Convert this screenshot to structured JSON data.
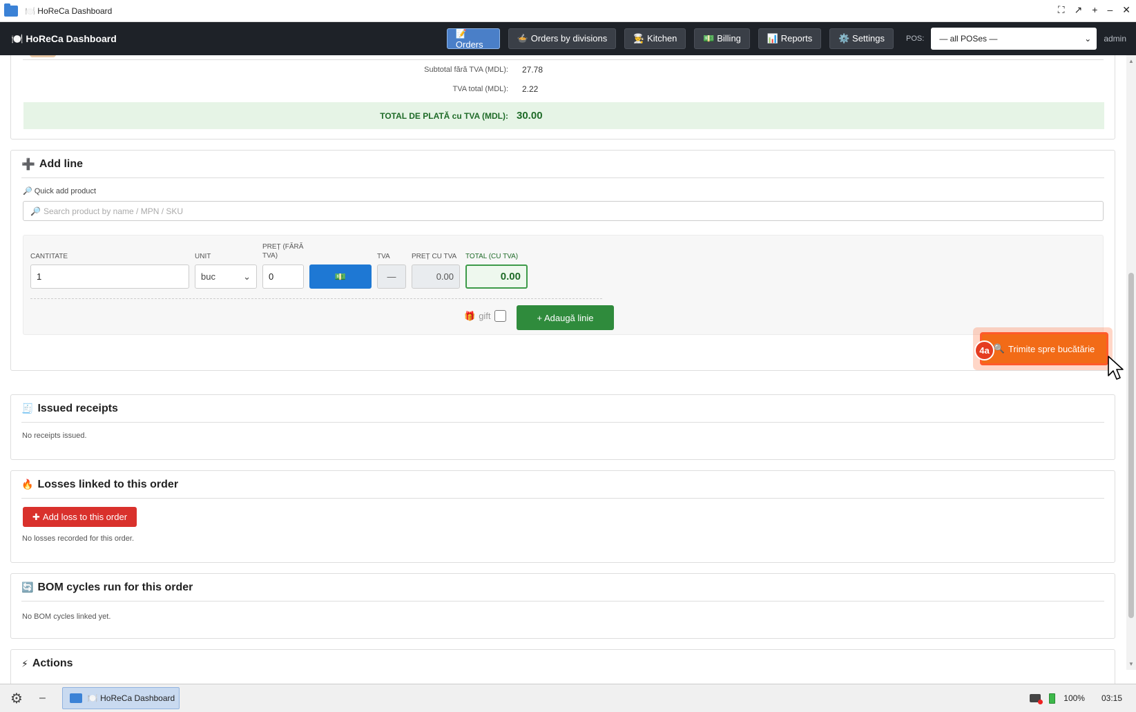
{
  "window": {
    "title": "🍽️ HoReCa Dashboard",
    "controls": [
      "⛶",
      "↗",
      "+",
      "–",
      "✕"
    ]
  },
  "header": {
    "brand": "🍽️ HoReCa Dashboard",
    "nav": [
      {
        "label": "📝 Orders",
        "active": true
      },
      {
        "label": "🍲 Orders by divisions",
        "active": false
      },
      {
        "label": "👨‍🍳 Kitchen",
        "active": false
      },
      {
        "label": "💵 Billing",
        "active": false
      },
      {
        "label": "📊 Reports",
        "active": false
      },
      {
        "label": "⚙️ Settings",
        "active": false
      }
    ],
    "pos_label": "POS:",
    "pos_selected": "— all POSes —",
    "user": "admin"
  },
  "totals": {
    "subtotal_label": "Subtotal fără TVA (MDL):",
    "subtotal_value": "27.78",
    "vat_label": "TVA total (MDL):",
    "vat_value": "2.22",
    "grand_label": "TOTAL DE PLATĂ cu TVA (MDL):",
    "grand_value": "30.00"
  },
  "add_line": {
    "title": "Add line",
    "quick_add_label": "🔎 Quick add product",
    "search_placeholder": "Search product by name / MPN / SKU",
    "fields": {
      "qty_label": "CANTITATE",
      "qty_value": "1",
      "unit_label": "UNIT",
      "unit_value": "buc",
      "price_label": "PREȚ (FĂRĂ TVA)",
      "price_value": "0",
      "price_btn": "💵",
      "vat_label": "TVA",
      "vat_value": "—",
      "price_vat_label": "PREȚ CU TVA",
      "price_vat_value": "0.00",
      "total_label": "TOTAL (CU TVA)",
      "total_value": "0.00"
    },
    "gift_label": "gift",
    "add_button": "+ Adaugă linie",
    "kitchen_button": "Trimite spre bucătărie",
    "step_badge": "4a"
  },
  "receipts": {
    "title": "Issued receipts",
    "empty": "No receipts issued."
  },
  "losses": {
    "title": "Losses linked to this order",
    "add_button": "Add loss to this order",
    "empty": "No losses recorded for this order."
  },
  "bom": {
    "title": "BOM cycles run for this order",
    "empty": "No BOM cycles linked yet."
  },
  "actions": {
    "title": "Actions"
  },
  "taskbar": {
    "task_label": "🍽️ HoReCa Dashboard",
    "battery": "100%",
    "time": "03:15"
  },
  "colors": {
    "accent": "#4a7fc8",
    "success": "#2f8b3c",
    "danger": "#d9312c",
    "kitchen": "#f26b17"
  }
}
